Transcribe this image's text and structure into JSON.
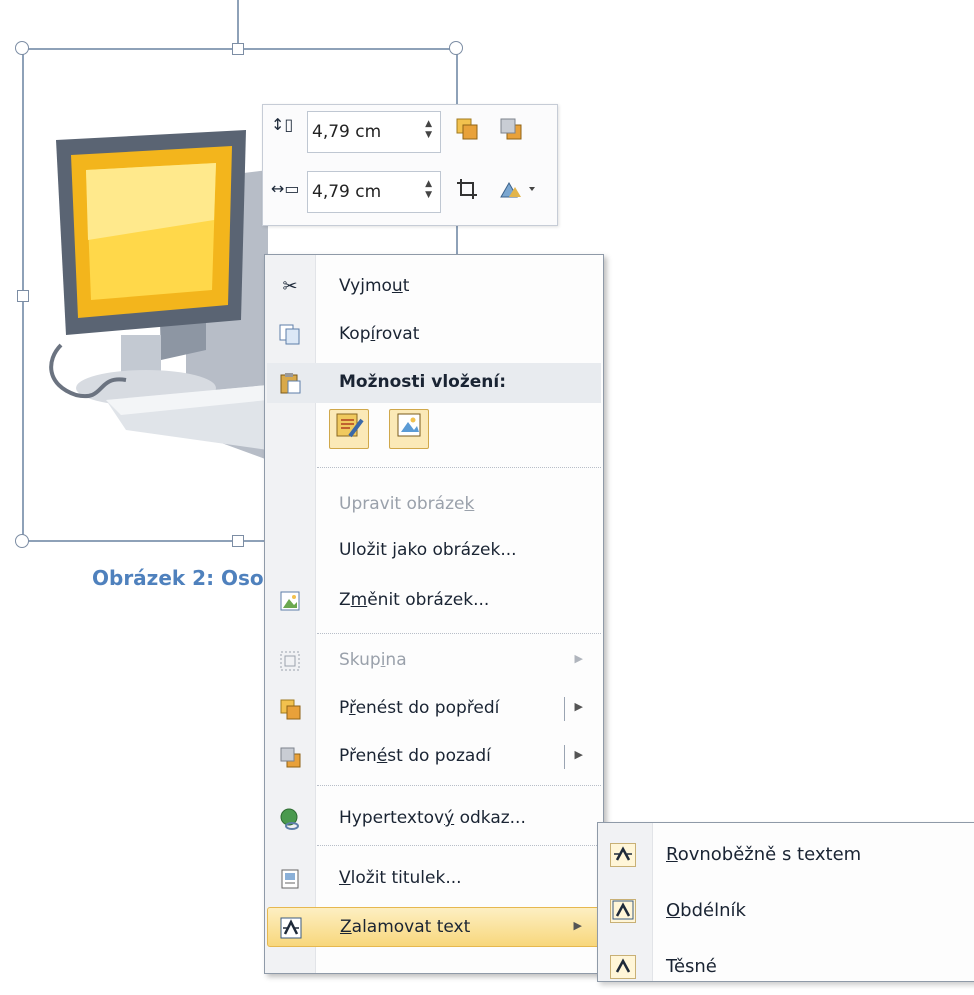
{
  "mini_toolbar": {
    "height_value": "4,79 cm",
    "width_value": "4,79 cm"
  },
  "caption": "Obrázek 2: Oso",
  "context_menu": {
    "items": [
      {
        "pre": "Vyjmo",
        "u": "u",
        "post": "t",
        "icon": "scissors-icon",
        "disabled": false
      },
      {
        "pre": "Kop",
        "u": "í",
        "post": "rovat",
        "icon": "copy-icon",
        "disabled": false
      },
      {
        "label": "Možnosti vložení:",
        "icon": "paste-icon",
        "header": true
      },
      {
        "pre": "Upravit obráze",
        "u": "k",
        "post": "",
        "disabled": true
      },
      {
        "pre": "Uložit ",
        "u": "j",
        "post": "ako obrázek...",
        "disabled": false
      },
      {
        "pre": "Z",
        "u": "m",
        "post": "ěnit obrázek...",
        "icon": "change-picture-icon",
        "disabled": false
      },
      {
        "pre": "Skup",
        "u": "i",
        "post": "na",
        "icon": "group-icon",
        "disabled": true
      },
      {
        "pre": "P",
        "u": "ř",
        "post": "enést do popředí",
        "icon": "bring-forward-icon",
        "disabled": false
      },
      {
        "pre": "Přen",
        "u": "é",
        "post": "st do pozadí",
        "icon": "send-backward-icon",
        "disabled": false
      },
      {
        "pre": "Hypertextov",
        "u": "ý",
        "post": " odkaz...",
        "icon": "hyperlink-icon",
        "disabled": false
      },
      {
        "pre": "",
        "u": "V",
        "post": "ložit titulek...",
        "icon": "insert-caption-icon",
        "disabled": false
      },
      {
        "pre": "",
        "u": "Z",
        "post": "alamovat text",
        "icon": "wrap-text-icon",
        "disabled": false
      }
    ]
  },
  "submenu": {
    "items": [
      {
        "pre": "",
        "u": "R",
        "post": "ovnoběžně s textem"
      },
      {
        "pre": "",
        "u": "O",
        "post": "bdélník"
      },
      {
        "pre": "T",
        "u": "",
        "post": "ěsné"
      }
    ]
  }
}
